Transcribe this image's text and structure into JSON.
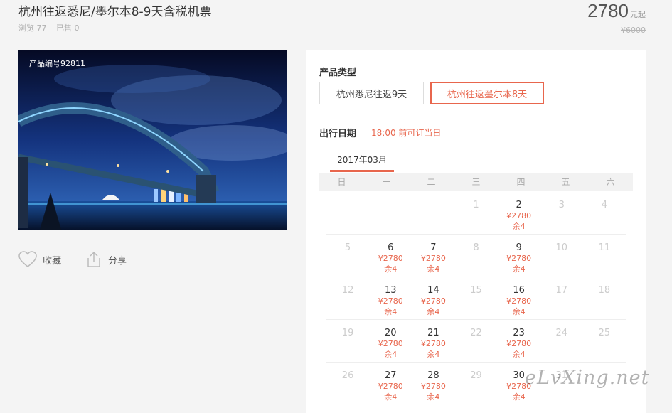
{
  "header": {
    "title": "杭州往返悉尼/墨尔本8-9天含税机票",
    "views": "浏览 77",
    "sold": "已售 0",
    "price": "2780",
    "price_unit": "元起",
    "original_price": "¥6000"
  },
  "photo": {
    "product_id": "产品编号92811"
  },
  "actions": {
    "favorite": "收藏",
    "share": "分享"
  },
  "booking": {
    "type_label": "产品类型",
    "options": [
      "杭州悉尼往返9天",
      "杭州往返墨尔本8天"
    ],
    "selected_option": 1,
    "date_label": "出行日期",
    "date_note": "18:00 前可订当日"
  },
  "calendar": {
    "month": "2017年03月",
    "weekdays": [
      "日",
      "一",
      "二",
      "三",
      "四",
      "五",
      "六"
    ],
    "weeks": [
      [
        {
          "day": ""
        },
        {
          "day": ""
        },
        {
          "day": ""
        },
        {
          "day": "1"
        },
        {
          "day": "2",
          "price": "¥2780",
          "stock": "余4"
        },
        {
          "day": "3"
        },
        {
          "day": "4"
        }
      ],
      [
        {
          "day": "5"
        },
        {
          "day": "6",
          "price": "¥2780",
          "stock": "余4"
        },
        {
          "day": "7",
          "price": "¥2780",
          "stock": "余4"
        },
        {
          "day": "8"
        },
        {
          "day": "9",
          "price": "¥2780",
          "stock": "余4"
        },
        {
          "day": "10"
        },
        {
          "day": "11"
        }
      ],
      [
        {
          "day": "12"
        },
        {
          "day": "13",
          "price": "¥2780",
          "stock": "余4"
        },
        {
          "day": "14",
          "price": "¥2780",
          "stock": "余4"
        },
        {
          "day": "15"
        },
        {
          "day": "16",
          "price": "¥2780",
          "stock": "余4"
        },
        {
          "day": "17"
        },
        {
          "day": "18"
        }
      ],
      [
        {
          "day": "19"
        },
        {
          "day": "20",
          "price": "¥2780",
          "stock": "余4"
        },
        {
          "day": "21",
          "price": "¥2780",
          "stock": "余4"
        },
        {
          "day": "22"
        },
        {
          "day": "23",
          "price": "¥2780",
          "stock": "余4"
        },
        {
          "day": "24"
        },
        {
          "day": "25"
        }
      ],
      [
        {
          "day": "26"
        },
        {
          "day": "27",
          "price": "¥2780",
          "stock": "余4"
        },
        {
          "day": "28",
          "price": "¥2780",
          "stock": "余4"
        },
        {
          "day": "29"
        },
        {
          "day": "30",
          "price": "¥2780",
          "stock": "余4"
        },
        {
          "day": "31"
        },
        {
          "day": ""
        }
      ]
    ]
  },
  "watermark": "eLvXing.net",
  "colors": {
    "accent": "#e8664d"
  }
}
